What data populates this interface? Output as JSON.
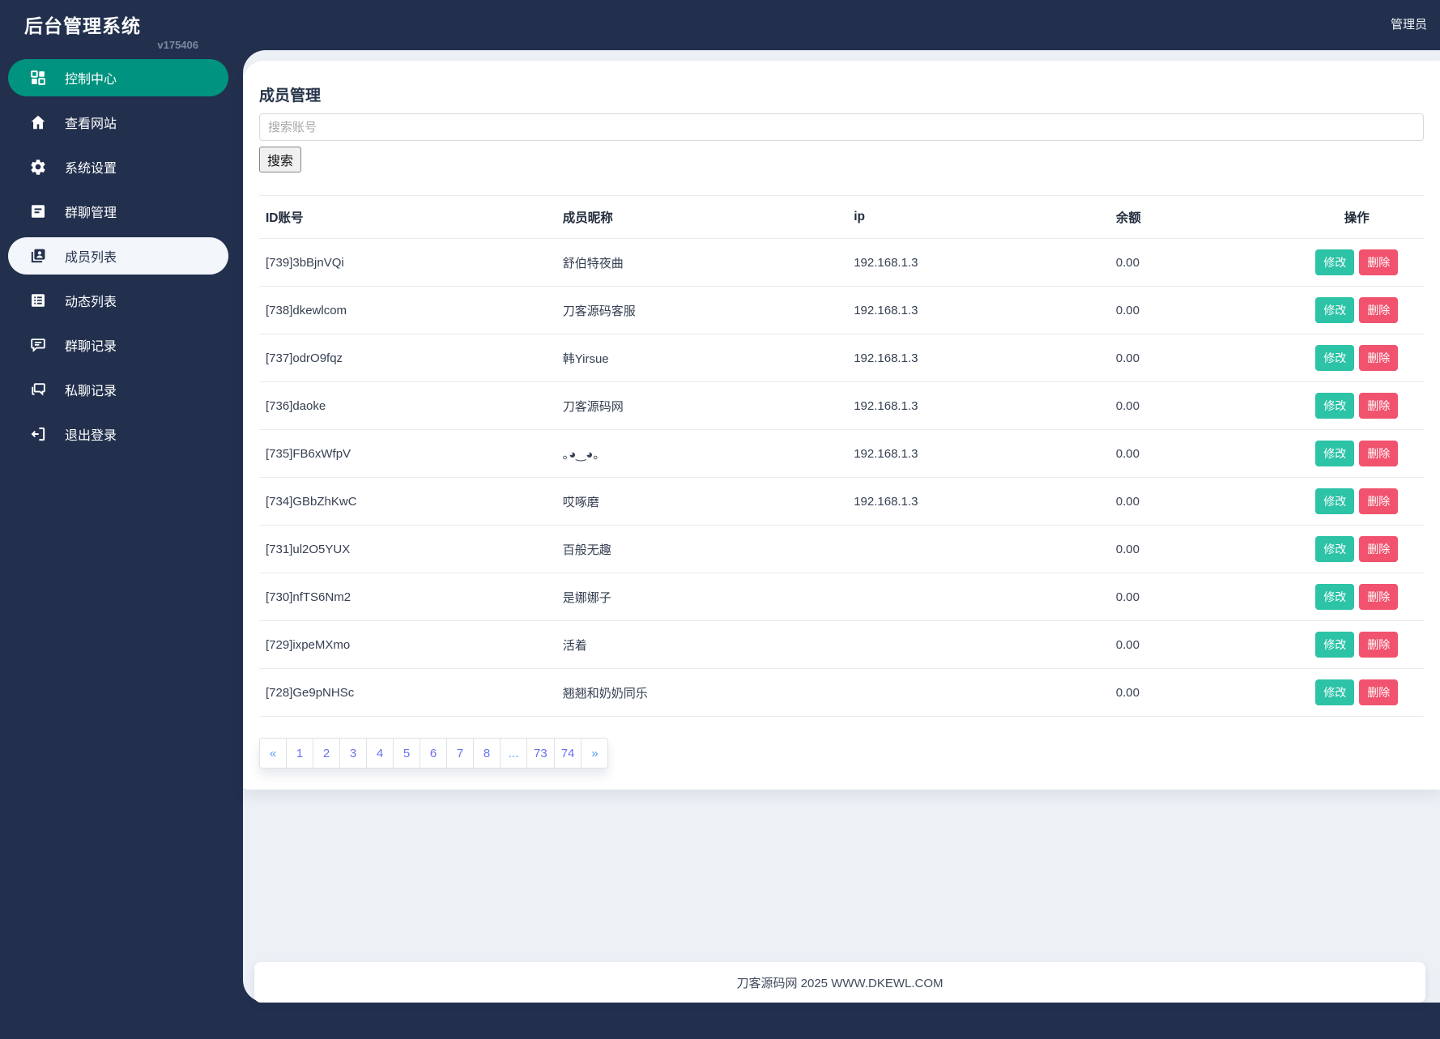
{
  "app": {
    "title": "后台管理系统",
    "version": "v175406",
    "user_label": "管理员"
  },
  "sidebar": {
    "items": [
      {
        "label": "控制中心",
        "icon": "grid-icon",
        "state": "active-teal"
      },
      {
        "label": "查看网站",
        "icon": "home-icon",
        "state": ""
      },
      {
        "label": "系统设置",
        "icon": "gear-icon",
        "state": ""
      },
      {
        "label": "群聊管理",
        "icon": "doc-lines-icon",
        "state": ""
      },
      {
        "label": "成员列表",
        "icon": "member-card-icon",
        "state": "active-light"
      },
      {
        "label": "动态列表",
        "icon": "list-grid-icon",
        "state": ""
      },
      {
        "label": "群聊记录",
        "icon": "chat-lines-icon",
        "state": ""
      },
      {
        "label": "私聊记录",
        "icon": "chat-double-icon",
        "state": ""
      },
      {
        "label": "退出登录",
        "icon": "logout-icon",
        "state": ""
      }
    ]
  },
  "page": {
    "title": "成员管理",
    "search": {
      "placeholder": "搜索账号",
      "value": "",
      "button_label": "搜索"
    },
    "table": {
      "headers": [
        "ID账号",
        "成员昵称",
        "ip",
        "余额",
        "操作"
      ],
      "actions": {
        "edit": "修改",
        "delete": "删除"
      },
      "rows": [
        {
          "id": "[739]3bBjnVQi",
          "nickname": "舒伯特夜曲",
          "ip": "192.168.1.3",
          "balance": "0.00"
        },
        {
          "id": "[738]dkewlcom",
          "nickname": "刀客源码客服",
          "ip": "192.168.1.3",
          "balance": "0.00"
        },
        {
          "id": "[737]odrO9fqz",
          "nickname": "韩Yirsue",
          "ip": "192.168.1.3",
          "balance": "0.00"
        },
        {
          "id": "[736]daoke",
          "nickname": "刀客源码网",
          "ip": "192.168.1.3",
          "balance": "0.00"
        },
        {
          "id": "[735]FB6xWfpV",
          "nickname": "｡◕‿◕｡",
          "ip": "192.168.1.3",
          "balance": "0.00"
        },
        {
          "id": "[734]GBbZhKwC",
          "nickname": "哎啄磨",
          "ip": "192.168.1.3",
          "balance": "0.00"
        },
        {
          "id": "[731]ul2O5YUX",
          "nickname": "百般无趣",
          "ip": "",
          "balance": "0.00"
        },
        {
          "id": "[730]nfTS6Nm2",
          "nickname": "是娜娜子",
          "ip": "",
          "balance": "0.00"
        },
        {
          "id": "[729]ixpeMXmo",
          "nickname": "活着",
          "ip": "",
          "balance": "0.00"
        },
        {
          "id": "[728]Ge9pNHSc",
          "nickname": "翘翘和奶奶同乐",
          "ip": "",
          "balance": "0.00"
        }
      ]
    },
    "pagination": [
      "«",
      "1",
      "2",
      "3",
      "4",
      "5",
      "6",
      "7",
      "8",
      "...",
      "73",
      "74",
      "»"
    ],
    "footer": "刀客源码网 2025 WWW.DKEWL.COM"
  },
  "colors": {
    "navy": "#22304e",
    "accent_teal": "#00937f",
    "button_edit": "#2cc3a7",
    "button_delete": "#f1536e",
    "pagination_number": "#6a71f0",
    "pagination_arrow": "#4a9cf6"
  }
}
